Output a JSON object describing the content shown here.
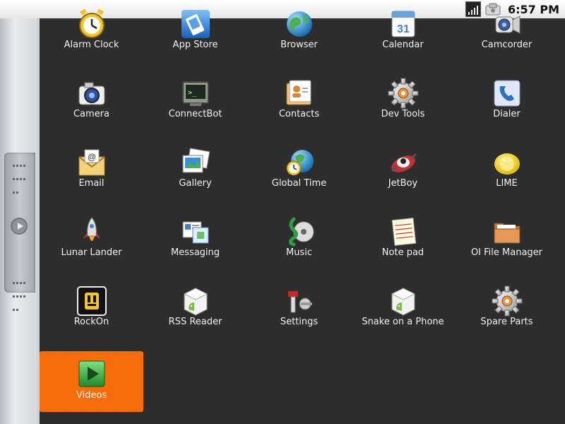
{
  "status_bar": {
    "time": "6:57 PM"
  },
  "apps": [
    {
      "label": "Alarm Clock",
      "icon": "alarm-clock-icon"
    },
    {
      "label": "App Store",
      "icon": "app-store-icon"
    },
    {
      "label": "Browser",
      "icon": "browser-globe-icon"
    },
    {
      "label": "Calendar",
      "icon": "calendar-icon"
    },
    {
      "label": "Camcorder",
      "icon": "camcorder-icon"
    },
    {
      "label": "Camera",
      "icon": "camera-icon"
    },
    {
      "label": "ConnectBot",
      "icon": "terminal-icon"
    },
    {
      "label": "Contacts",
      "icon": "contacts-icon"
    },
    {
      "label": "Dev Tools",
      "icon": "gear-icon"
    },
    {
      "label": "Dialer",
      "icon": "phone-icon"
    },
    {
      "label": "Email",
      "icon": "email-icon"
    },
    {
      "label": "Gallery",
      "icon": "gallery-icon"
    },
    {
      "label": "Global Time",
      "icon": "globe-clock-icon"
    },
    {
      "label": "JetBoy",
      "icon": "jetboy-icon"
    },
    {
      "label": "LIME",
      "icon": "lemon-icon"
    },
    {
      "label": "Lunar Lander",
      "icon": "rocket-icon"
    },
    {
      "label": "Messaging",
      "icon": "messaging-icon"
    },
    {
      "label": "Music",
      "icon": "music-icon"
    },
    {
      "label": "Note pad",
      "icon": "notepad-icon"
    },
    {
      "label": "OI File Manager",
      "icon": "folder-icon"
    },
    {
      "label": "RockOn",
      "icon": "rockon-icon"
    },
    {
      "label": "RSS Reader",
      "icon": "android-box-icon"
    },
    {
      "label": "Settings",
      "icon": "settings-icon"
    },
    {
      "label": "Snake on a Phone",
      "icon": "android-box-icon"
    },
    {
      "label": "Spare Parts",
      "icon": "gear-icon"
    },
    {
      "label": "Videos",
      "icon": "video-play-icon",
      "selected": true
    }
  ],
  "colors": {
    "selected": "#f76d0c",
    "drawer_bg": "#2c2c2c"
  }
}
